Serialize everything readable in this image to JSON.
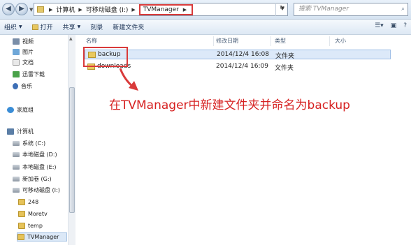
{
  "nav": {
    "back_icon": "back-arrow-icon",
    "forward_icon": "forward-arrow-icon"
  },
  "address": {
    "crumbs": [
      "计算机",
      "可移动磁盘 (I:)",
      "TVManager"
    ],
    "search_placeholder": "搜索 TVManager"
  },
  "toolbar": {
    "organize": "组织",
    "open": "打开",
    "share": "共享",
    "burn": "刻录",
    "new_folder": "新建文件夹"
  },
  "sidebar": {
    "items": [
      {
        "label": "视频",
        "icon": "video-icon"
      },
      {
        "label": "图片",
        "icon": "pictures-icon"
      },
      {
        "label": "文档",
        "icon": "documents-icon"
      },
      {
        "label": "迅雷下载",
        "icon": "thunder-download-icon"
      },
      {
        "label": "音乐",
        "icon": "music-icon"
      },
      {
        "label": "家庭组",
        "icon": "homegroup-icon"
      },
      {
        "label": "计算机",
        "icon": "computer-icon"
      },
      {
        "label": "系统 (C:)",
        "icon": "drive-icon"
      },
      {
        "label": "本地磁盘 (D:)",
        "icon": "drive-icon"
      },
      {
        "label": "本地磁盘 (E:)",
        "icon": "drive-icon"
      },
      {
        "label": "新加卷 (G:)",
        "icon": "drive-icon"
      },
      {
        "label": "可移动磁盘 (I:)",
        "icon": "removable-drive-icon"
      },
      {
        "label": "248",
        "icon": "folder-icon"
      },
      {
        "label": "Moretv",
        "icon": "folder-icon"
      },
      {
        "label": "temp",
        "icon": "folder-icon"
      },
      {
        "label": "TVManager",
        "icon": "folder-icon"
      }
    ]
  },
  "columns": {
    "name": "名称",
    "modified": "修改日期",
    "type": "类型",
    "size": "大小"
  },
  "files": [
    {
      "name": "backup",
      "modified": "2014/12/4 16:08",
      "type": "文件夹",
      "size": ""
    },
    {
      "name": "downloads",
      "modified": "2014/12/4 16:09",
      "type": "文件夹",
      "size": ""
    }
  ],
  "annotation": {
    "text": "在TVManager中新建文件夹并命名为backup",
    "color": "#d62020"
  }
}
